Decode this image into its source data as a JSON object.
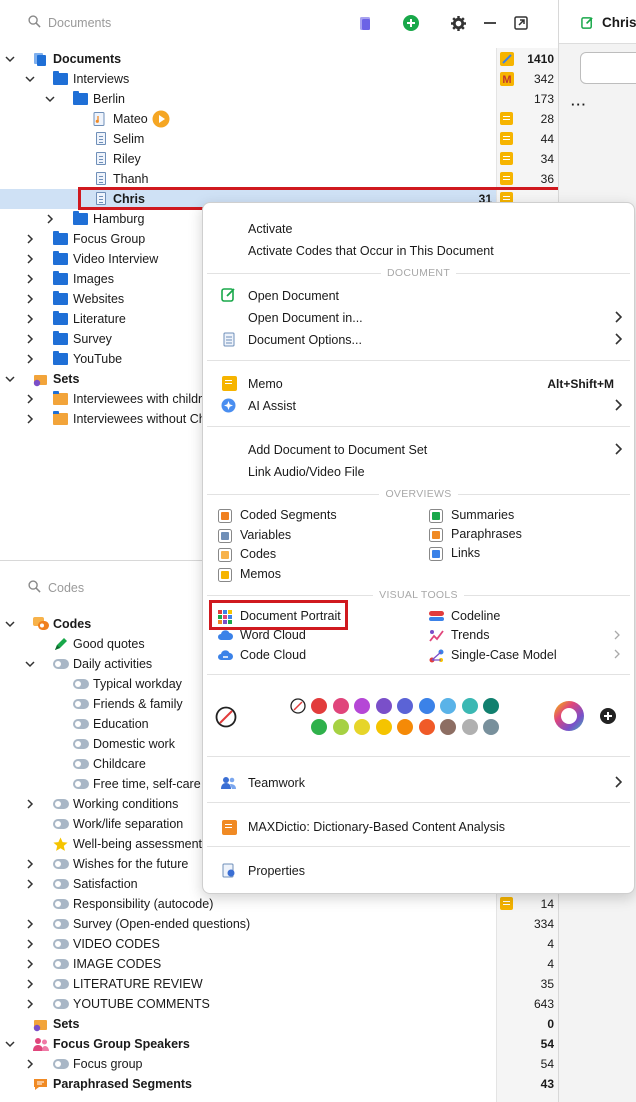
{
  "documents_panel": {
    "search_placeholder": "Documents",
    "tree": [
      {
        "label": "Documents",
        "bold": true,
        "level": 0,
        "icon": "documents-stack-icon",
        "chev": "down",
        "count": "1410",
        "count_bold": true,
        "memo": "yellow"
      },
      {
        "label": "Interviews",
        "level": 1,
        "icon": "folder-icon",
        "chev": "down",
        "count": "342",
        "memo": "M"
      },
      {
        "label": "Berlin",
        "level": 2,
        "icon": "folder-icon",
        "chev": "down",
        "count": "173"
      },
      {
        "label": "Mateo",
        "level": 3,
        "icon": "audio-document-icon",
        "count": "28",
        "memo": "memo",
        "play": true
      },
      {
        "label": "Selim",
        "level": 3,
        "icon": "text-document-icon",
        "count": "44",
        "memo": "memo"
      },
      {
        "label": "Riley",
        "level": 3,
        "icon": "text-document-icon",
        "count": "34",
        "memo": "memo"
      },
      {
        "label": "Thanh",
        "level": 3,
        "icon": "text-document-icon",
        "count": "36",
        "memo": "memo"
      },
      {
        "label": "Chris",
        "bold": true,
        "level": 3,
        "icon": "text-document-icon",
        "count": "31",
        "count_bold": true,
        "memo": "memo",
        "selected": true
      },
      {
        "label": "Hamburg",
        "level": 2,
        "icon": "folder-icon",
        "chev": "right"
      },
      {
        "label": "Focus Group",
        "level": 1,
        "icon": "folder-icon",
        "chev": "right"
      },
      {
        "label": "Video Interview",
        "level": 1,
        "icon": "folder-icon",
        "chev": "right"
      },
      {
        "label": "Images",
        "level": 1,
        "icon": "folder-icon",
        "chev": "right"
      },
      {
        "label": "Websites",
        "level": 1,
        "icon": "folder-icon",
        "chev": "right"
      },
      {
        "label": "Literature",
        "level": 1,
        "icon": "folder-icon",
        "chev": "right"
      },
      {
        "label": "Survey",
        "level": 1,
        "icon": "folder-icon",
        "chev": "right"
      },
      {
        "label": "YouTube",
        "level": 1,
        "icon": "folder-icon",
        "chev": "right"
      },
      {
        "label": "Sets",
        "bold": true,
        "level": 0,
        "icon": "sets-icon",
        "chev": "down"
      },
      {
        "label": "Interviewees with childre",
        "level": 1,
        "icon": "set-folder-icon",
        "chev": "right"
      },
      {
        "label": "Interviewees without Chi",
        "level": 1,
        "icon": "set-folder-icon",
        "chev": "right"
      }
    ]
  },
  "codes_panel": {
    "search_placeholder": "Codes",
    "tree": [
      {
        "label": "Codes",
        "bold": true,
        "level": 0,
        "icon": "codes-icon",
        "chev": "down"
      },
      {
        "label": "Good quotes",
        "level": 1,
        "icon": "pen-icon"
      },
      {
        "label": "Daily activities",
        "level": 1,
        "icon": "code-icon",
        "chev": "down"
      },
      {
        "label": "Typical workday",
        "level": 2,
        "icon": "code-icon"
      },
      {
        "label": "Friends & family",
        "level": 2,
        "icon": "code-icon"
      },
      {
        "label": "Education",
        "level": 2,
        "icon": "code-icon"
      },
      {
        "label": "Domestic work",
        "level": 2,
        "icon": "code-icon"
      },
      {
        "label": "Childcare",
        "level": 2,
        "icon": "code-icon"
      },
      {
        "label": "Free time, self-care",
        "level": 2,
        "icon": "code-icon"
      },
      {
        "label": "Working conditions",
        "level": 1,
        "icon": "code-icon",
        "chev": "right"
      },
      {
        "label": "Work/life separation",
        "level": 1,
        "icon": "code-icon"
      },
      {
        "label": "Well-being assessment",
        "level": 1,
        "icon": "star-icon"
      },
      {
        "label": "Wishes for the future",
        "level": 1,
        "icon": "code-icon",
        "chev": "right"
      },
      {
        "label": "Satisfaction",
        "level": 1,
        "icon": "code-icon",
        "chev": "right"
      },
      {
        "label": "Responsibility (autocode)",
        "level": 1,
        "icon": "code-icon",
        "count": "14",
        "memo": "memo"
      },
      {
        "label": "Survey (Open-ended questions)",
        "level": 1,
        "icon": "code-icon",
        "chev": "right",
        "count": "334"
      },
      {
        "label": "VIDEO CODES",
        "level": 1,
        "icon": "code-icon",
        "chev": "right",
        "count": "4"
      },
      {
        "label": "IMAGE CODES",
        "level": 1,
        "icon": "code-icon",
        "chev": "right",
        "count": "4"
      },
      {
        "label": "LITERATURE REVIEW",
        "level": 1,
        "icon": "code-icon",
        "chev": "right",
        "count": "35"
      },
      {
        "label": "YOUTUBE COMMENTS",
        "level": 1,
        "icon": "code-icon",
        "chev": "right",
        "count": "643"
      },
      {
        "label": "Sets",
        "bold": true,
        "level": 0,
        "icon": "sets-icon",
        "count": "0",
        "count_bold": true
      },
      {
        "label": "Focus Group Speakers",
        "bold": true,
        "level": 0,
        "icon": "speakers-icon",
        "chev": "down",
        "count": "54",
        "count_bold": true
      },
      {
        "label": "Focus group",
        "level": 1,
        "icon": "code-icon",
        "chev": "right",
        "count": "54"
      },
      {
        "label": "Paraphrased Segments",
        "bold": true,
        "level": 0,
        "icon": "paraphrase-icon",
        "count": "43",
        "count_bold": true
      }
    ]
  },
  "right_panel": {
    "title": "Chris"
  },
  "context_menu": {
    "activate": "Activate",
    "activate_codes": "Activate Codes that Occur in This Document",
    "section_document": "DOCUMENT",
    "open_document": "Open Document",
    "open_document_in": "Open Document in...",
    "document_options": "Document Options...",
    "memo": "Memo",
    "memo_shortcut": "Alt+Shift+M",
    "ai_assist": "AI Assist",
    "add_to_set": "Add Document to Document Set",
    "link_av": "Link Audio/Video File",
    "section_overviews": "OVERVIEWS",
    "overviews_left": [
      "Coded Segments",
      "Variables",
      "Codes",
      "Memos"
    ],
    "overviews_right": [
      "Summaries",
      "Paraphrases",
      "Links"
    ],
    "section_visual": "VISUAL TOOLS",
    "visual_left": [
      "Document Portrait",
      "Word Cloud",
      "Code Cloud"
    ],
    "visual_right": [
      "Codeline",
      "Trends",
      "Single-Case Model"
    ],
    "colors_row1": [
      "#e23c3c",
      "#e0457b",
      "#b547d6",
      "#7a4fc9",
      "#5b63d6",
      "#3b82e8",
      "#5ab3e8",
      "#3bb8b3",
      "#11806f"
    ],
    "colors_row2": [
      "#2fb14b",
      "#a6d143",
      "#e6d52a",
      "#f5c400",
      "#f58a07",
      "#f05a28",
      "#8d6e63",
      "#b0b0b0",
      "#78909c"
    ],
    "teamwork": "Teamwork",
    "maxdictio": "MAXDictio: Dictionary-Based Content Analysis",
    "properties": "Properties"
  }
}
